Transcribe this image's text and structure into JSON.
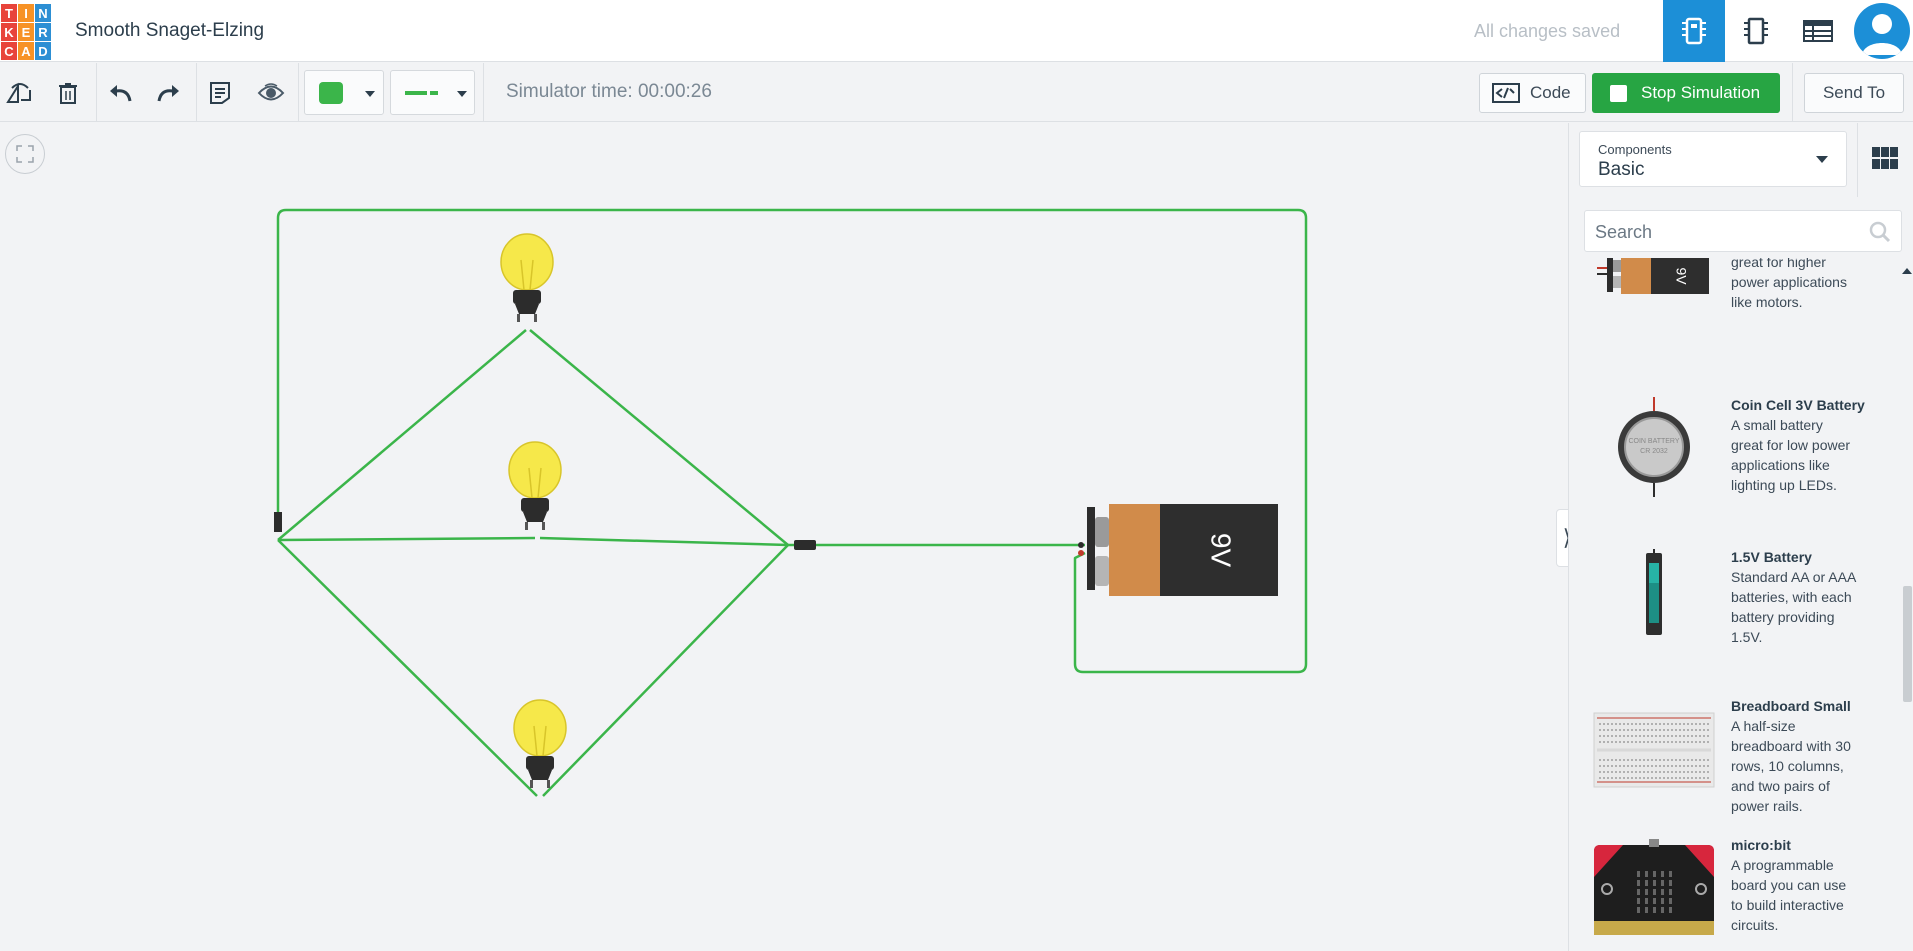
{
  "app": {
    "logo_letters": [
      "T",
      "I",
      "N",
      "K",
      "E",
      "R",
      "C",
      "A",
      "D"
    ],
    "logo_colors": [
      "#e8443b",
      "#f79225",
      "#2c8fd4",
      "#e8443b",
      "#f79225",
      "#2c8fd4",
      "#e8443b",
      "#f79225",
      "#2c8fd4"
    ],
    "project_title": "Smooth Snaget-Elzing",
    "save_status": "All changes saved"
  },
  "toolbar": {
    "simulator_time": "Simulator time: 00:00:26",
    "code_label": "Code",
    "stop_label": "Stop Simulation",
    "send_label": "Send To",
    "fill_color": "#3bb54a",
    "accent": "#1c8fd7",
    "stop_color": "#27a543"
  },
  "circuit": {
    "wire_color": "#3bb54a",
    "battery_label": "9V"
  },
  "panel": {
    "components_label": "Components",
    "components_value": "Basic",
    "search_placeholder": "Search",
    "items": [
      {
        "name": "",
        "desc_lines": [
          "great for higher",
          "power applications",
          "like motors."
        ],
        "icon": "9v-battery-icon"
      },
      {
        "name": "Coin Cell 3V Battery",
        "desc_lines": [
          "A small battery",
          "great for low power",
          "applications like",
          "lighting up LEDs."
        ],
        "icon": "coin-cell-icon"
      },
      {
        "name": "1.5V Battery",
        "desc_lines": [
          "Standard AA or AAA",
          "batteries, with each",
          "battery providing",
          "1.5V."
        ],
        "icon": "aa-battery-icon"
      },
      {
        "name": "Breadboard Small",
        "desc_lines": [
          "A half-size",
          "breadboard with 30",
          "rows, 10 columns,",
          "and two pairs of",
          "power rails."
        ],
        "icon": "breadboard-icon"
      },
      {
        "name": "micro:bit",
        "desc_lines": [
          "A programmable",
          "board you can use",
          "to build interactive",
          "circuits."
        ],
        "icon": "microbit-icon"
      }
    ]
  }
}
